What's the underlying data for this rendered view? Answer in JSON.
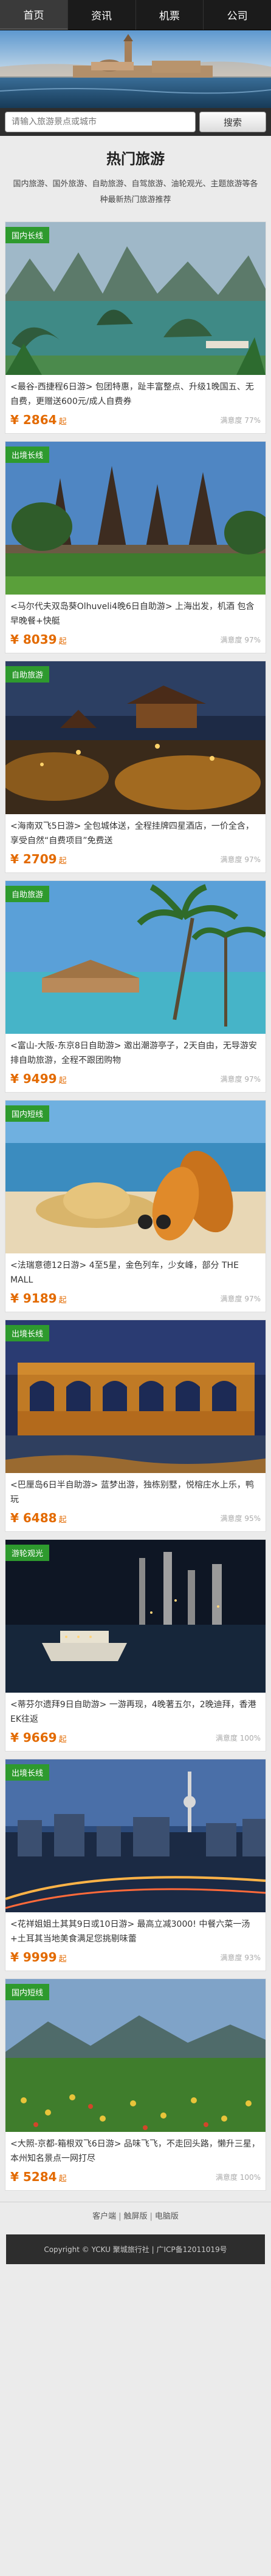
{
  "nav": {
    "items": [
      {
        "label": "首页",
        "active": true
      },
      {
        "label": "资讯",
        "active": false
      },
      {
        "label": "机票",
        "active": false
      },
      {
        "label": "公司",
        "active": false
      }
    ]
  },
  "search": {
    "placeholder": "请输入旅游景点或城市",
    "button": "搜索"
  },
  "section": {
    "title": "热门旅游",
    "intro": "国内旅游、国外旅游、自助旅游、自驾旅游、油轮观光、主题旅游等各种最新热门旅游推荐"
  },
  "cards": [
    {
      "badge": "国内长线",
      "title": "<最谷-西捷程6日游> 包团特惠，趾丰富整点、升级1晚国五、无自费，更赠送600元/成人自费券",
      "price": "2864",
      "unit": "起",
      "satisfaction": "满意度 77%"
    },
    {
      "badge": "出境长线",
      "title": "<马尔代夫双岛葵Olhuveli4晚6日自助游> 上海出发，机酒 包含 早晚餐+快艇",
      "price": "8039",
      "unit": "起",
      "satisfaction": "满意度 97%"
    },
    {
      "badge": "自助旅游",
      "title": "<海南双飞5日游> 全包城体送，全程挂牌四星酒店，一价全含，享受自然“自费项目”免费送",
      "price": "2709",
      "unit": "起",
      "satisfaction": "满意度 97%"
    },
    {
      "badge": "自助旅游",
      "title": "<富山-大阪-东京8日自助游> 邀出潮游亭子，2天自由，无导游安排自助旅游，全程不跟团购物",
      "price": "9499",
      "unit": "起",
      "satisfaction": "满意度 97%"
    },
    {
      "badge": "国内短线",
      "title": "<法瑞意德12日游> 4至5星，金色列车，少女峰，部分 THE MALL",
      "price": "9189",
      "unit": "起",
      "satisfaction": "满意度 97%"
    },
    {
      "badge": "出境长线",
      "title": "<巴厘岛6日半自助游> 蓝梦出游，独栋别墅，悦榕庄水上乐，鸭玩",
      "price": "6488",
      "unit": "起",
      "satisfaction": "满意度 95%"
    },
    {
      "badge": "游轮观光",
      "title": "<蒂芬尔遗拜9日自助游> 一游再现，4晚著五尔，2晚迪拜，香港EK往返",
      "price": "9669",
      "unit": "起",
      "satisfaction": "满意度 100%"
    },
    {
      "badge": "出境长线",
      "title": "<花祥姐姐土其其9日或10日游> 最高立减3000! 中餐六菜一汤+土耳其当地美食满足您挑剔味蕾",
      "price": "9999",
      "unit": "起",
      "satisfaction": "满意度 93%"
    },
    {
      "badge": "国内短线",
      "title": "<大照-京都-箱根双飞6日游> 品味飞飞，不走回头路，懒升三星，本州知名景点一网打尽",
      "price": "5284",
      "unit": "起",
      "satisfaction": "满意度 100%"
    }
  ],
  "footer": {
    "links": [
      "客户端",
      "触屏版",
      "电脑版"
    ],
    "copyright": "Copyright © YCKU 聚城旅行社 | 广ICP备12011019号"
  },
  "colors": {
    "price": "#e36a00",
    "badge": "#2e9a2e",
    "nav_bg": "#1b1b1b"
  }
}
